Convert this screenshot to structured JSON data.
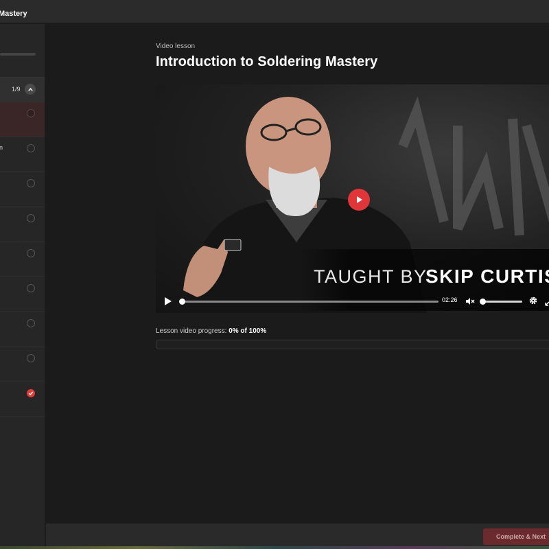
{
  "window": {
    "title": "Mastery"
  },
  "sidebar": {
    "course_progress": 0,
    "section": {
      "count": "1/9"
    },
    "lessons": [
      {
        "state": "current",
        "label_fragment": ""
      },
      {
        "state": "incomplete",
        "label_fragment": "n"
      },
      {
        "state": "incomplete",
        "label_fragment": ""
      },
      {
        "state": "incomplete",
        "label_fragment": ""
      },
      {
        "state": "incomplete",
        "label_fragment": ""
      },
      {
        "state": "incomplete",
        "label_fragment": ""
      },
      {
        "state": "incomplete",
        "label_fragment": ""
      },
      {
        "state": "incomplete",
        "label_fragment": ""
      },
      {
        "state": "complete",
        "label_fragment": ""
      }
    ]
  },
  "lesson": {
    "kicker": "Video lesson",
    "title": "Introduction to Soldering Mastery"
  },
  "video": {
    "overlay_prefix": "TAUGHT BY",
    "overlay_name": "SKIP CURTIS",
    "time": "02:26",
    "played_fraction": 0,
    "volume_fraction": 0,
    "muted": true
  },
  "progress": {
    "label": "Lesson video progress:",
    "value": "0% of 100%",
    "percent": 0
  },
  "footer": {
    "next_label": "Complete & Next"
  },
  "colors": {
    "accent": "#e0363a",
    "background": "#1b1b1b",
    "sidebar": "#262626"
  },
  "icons": [
    "chevron-up-icon",
    "play-icon",
    "mute-icon",
    "gear-icon",
    "fullscreen-icon",
    "check-icon"
  ]
}
